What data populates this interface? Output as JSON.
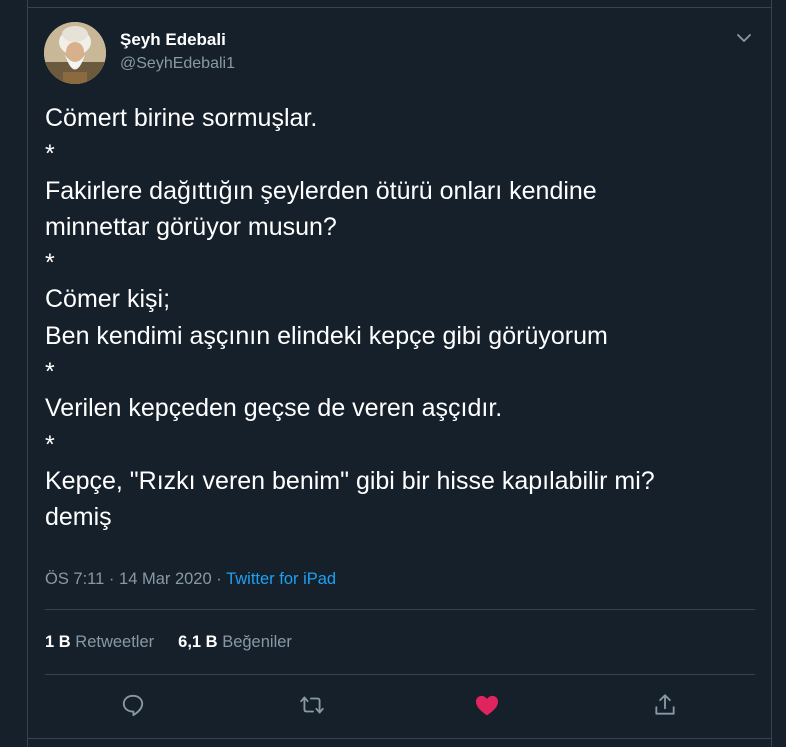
{
  "author": {
    "name": "Şeyh Edebali",
    "handle": "@SeyhEdebali1"
  },
  "tweet": {
    "lines": [
      "Cömert birine sormuşlar.",
      "*",
      "Fakirlere dağıttığın şeylerden ötürü onları kendine",
      "minnettar görüyor musun?",
      "*",
      "Cömer kişi;",
      "Ben kendimi aşçının elindeki kepçe gibi görüyorum",
      "*",
      "Verilen kepçeden geçse de veren aşçıdır.",
      "*",
      "Kepçe, \"Rızkı veren benim\" gibi bir hisse kapılabilir mi?",
      "demiş"
    ]
  },
  "meta": {
    "time": "ÖS 7:11",
    "separator": "·",
    "date": "14 Mar 2020",
    "source": "Twitter for iPad"
  },
  "stats": {
    "retweets_count": "1 B",
    "retweets_label": "Retweetler",
    "likes_count": "6,1 B",
    "likes_label": "Beğeniler"
  },
  "actions": {
    "reply_icon": "reply-icon",
    "retweet_icon": "retweet-icon",
    "like_icon": "heart-icon",
    "share_icon": "share-icon",
    "like_color": "#e0245e"
  },
  "colors": {
    "background": "#15202b",
    "secondary_text": "#8899a6",
    "link": "#1da1f2",
    "border": "#38444d"
  }
}
